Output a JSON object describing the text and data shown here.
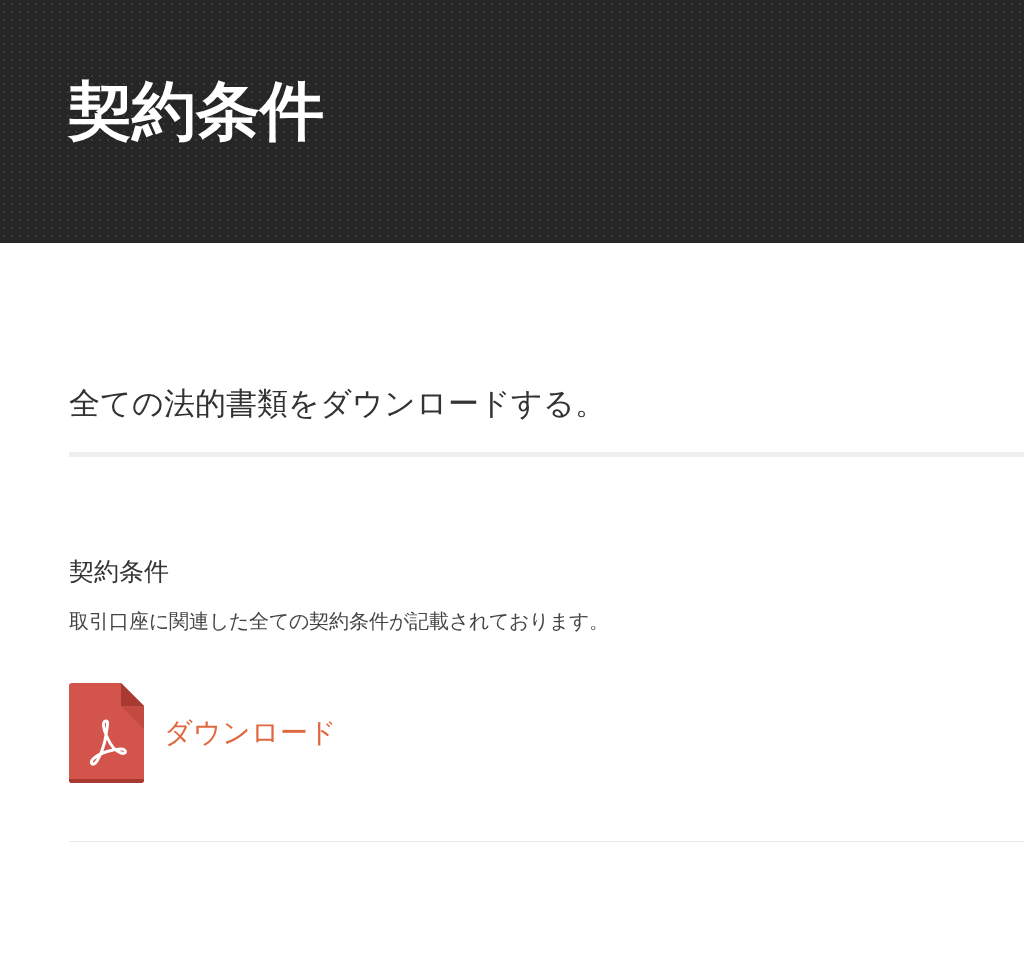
{
  "header": {
    "title": "契約条件"
  },
  "intro": "全ての法的書類をダウンロードする。",
  "documents": [
    {
      "title": "契約条件",
      "description": "取引口座に関連した全ての契約条件が記載されております。",
      "link": "ダウンロード"
    }
  ]
}
